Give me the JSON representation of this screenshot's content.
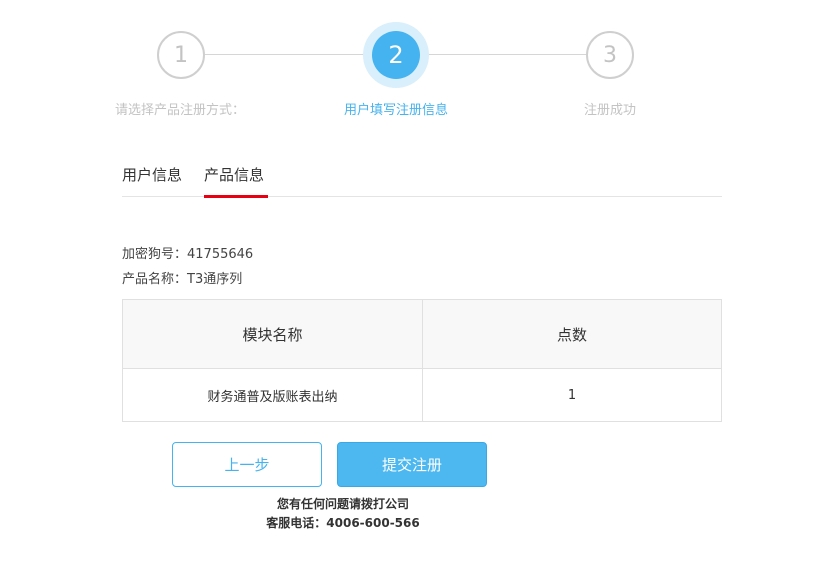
{
  "stepper": {
    "steps": [
      {
        "number": "1",
        "label": "请选择产品注册方式："
      },
      {
        "number": "2",
        "label": "用户填写注册信息"
      },
      {
        "number": "3",
        "label": "注册成功"
      }
    ],
    "active_step": 2,
    "colors": {
      "active": "#45b3ef",
      "inactive": "#c3c3c3"
    }
  },
  "tabs": [
    {
      "label": "用户信息"
    },
    {
      "label": "产品信息",
      "active": true
    }
  ],
  "info": {
    "dongle": "加密狗号：41755646",
    "product": "产品名称：T3通序列"
  },
  "table": {
    "headers": [
      "模块名称",
      "点数"
    ],
    "rows": [
      [
        "财务通普及版账表出纳",
        "1"
      ]
    ]
  },
  "buttons": {
    "prev": "上一步",
    "submit": "提交注册"
  },
  "footer": {
    "line1": "您有任何问题请拨打公司",
    "line2": "客服电话：4006-600-566"
  },
  "colors": {
    "accent": "#45b3ef",
    "tab_underline": "#e60012"
  }
}
